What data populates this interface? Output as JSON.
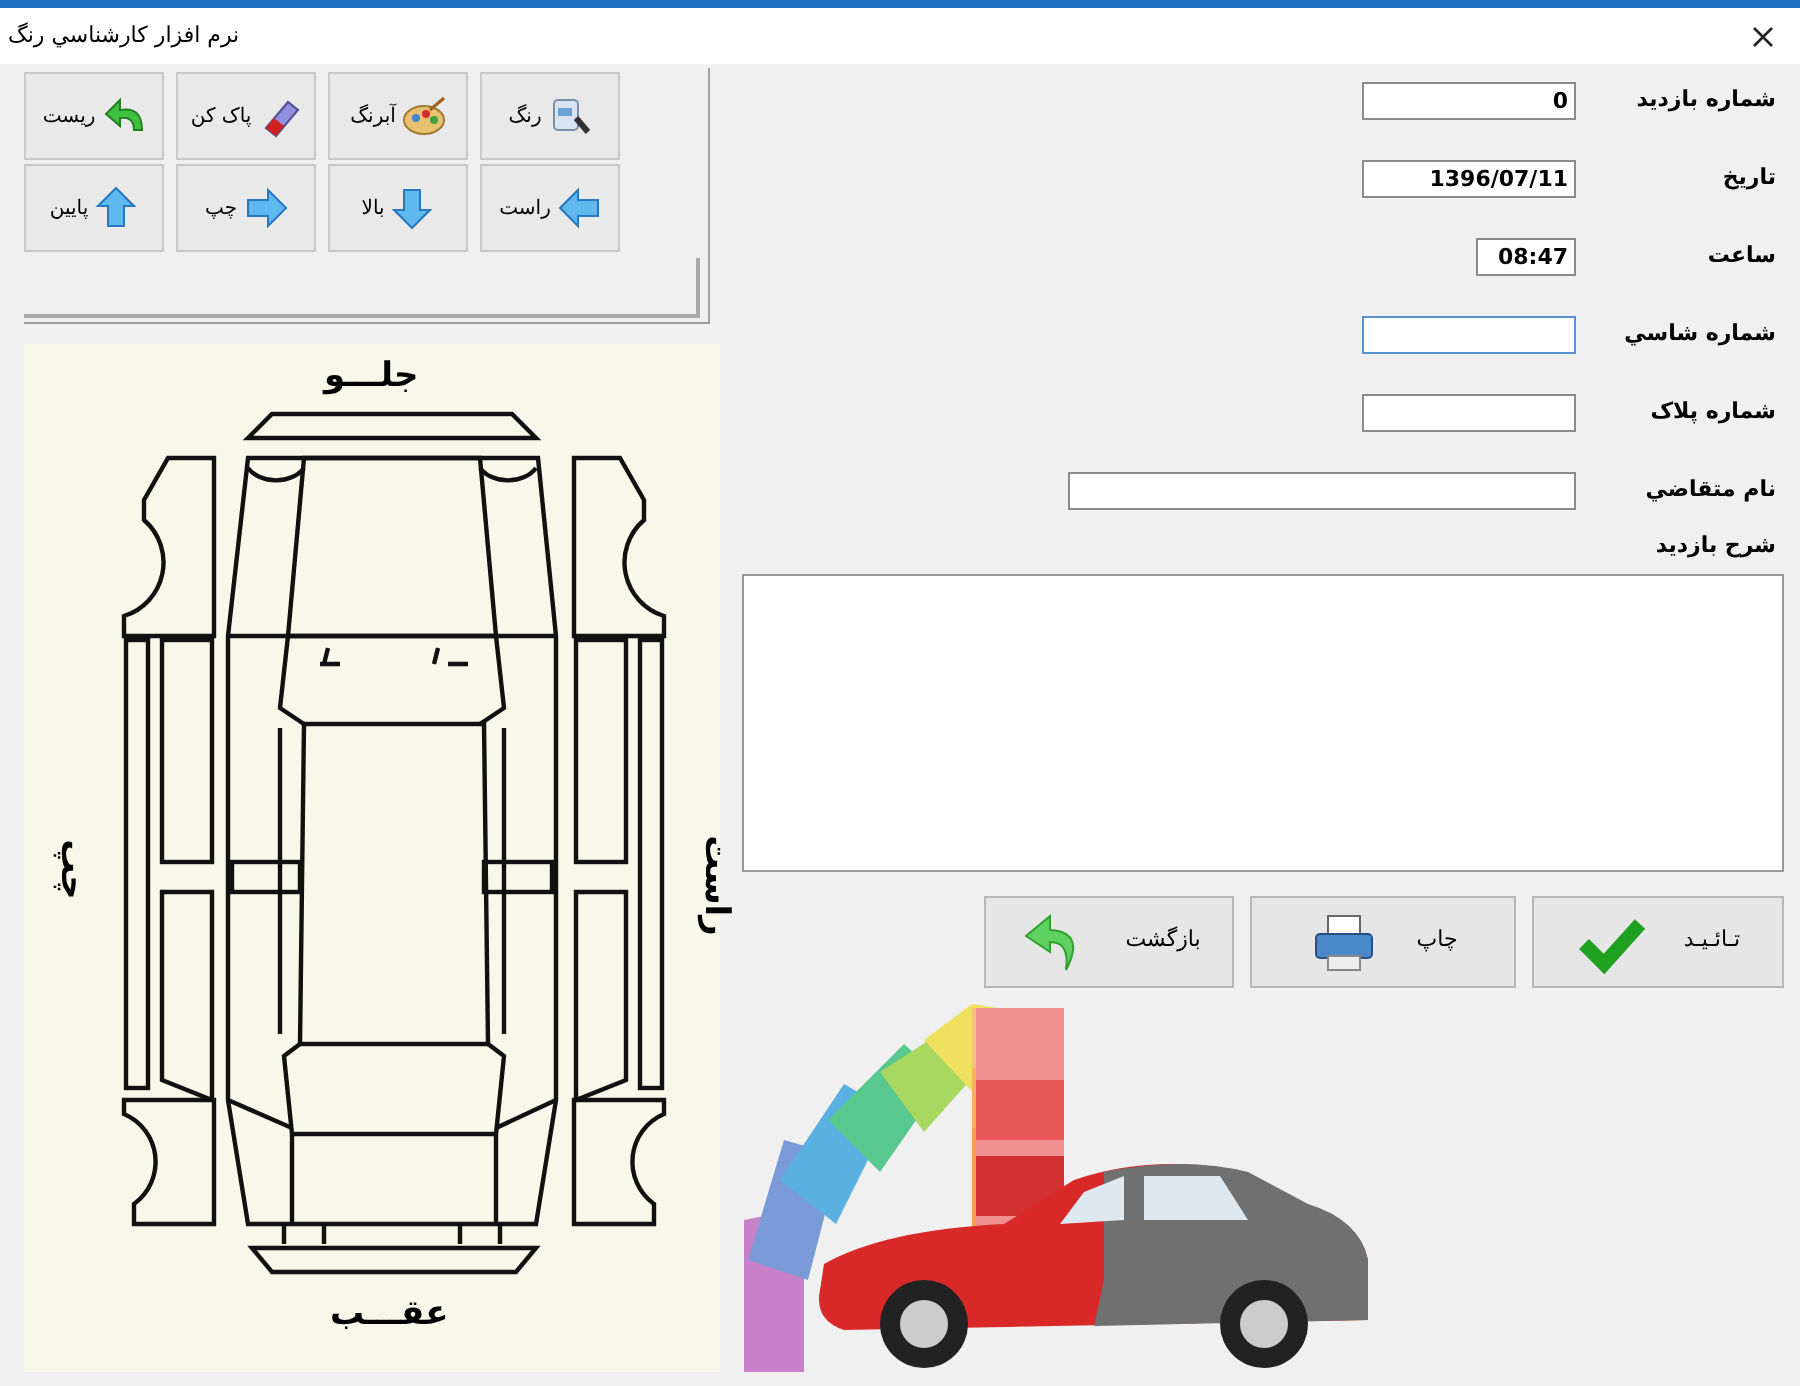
{
  "window": {
    "title": "نرم افزار کارشناسي رنگ"
  },
  "toolbar": {
    "buttons": [
      {
        "label": "رنگ",
        "kind": "paint"
      },
      {
        "label": "آبرنگ",
        "kind": "palette"
      },
      {
        "label": "پاک کن",
        "kind": "eraser"
      },
      {
        "label": "ریست",
        "kind": "reset"
      },
      {
        "label": "راست",
        "kind": "arrow-left"
      },
      {
        "label": "بالا",
        "kind": "arrow-down"
      },
      {
        "label": "چپ",
        "kind": "arrow-right"
      },
      {
        "label": "پایین",
        "kind": "arrow-up"
      }
    ]
  },
  "diagram": {
    "front": "جلـــو",
    "rear": "عقـــب",
    "left": "چپ",
    "right": "راست"
  },
  "form": {
    "fields": [
      {
        "label": "شماره بازدید",
        "value": "0",
        "focused": false
      },
      {
        "label": "تاریخ",
        "value": "1396/07/11",
        "focused": false
      },
      {
        "label": "ساعت",
        "value": "08:47",
        "focused": false
      },
      {
        "label": "شماره شاسي",
        "focused": true
      },
      {
        "label": "شماره پلاک",
        "focused": false
      },
      {
        "label": "نام متقاضي",
        "focused": false
      }
    ],
    "notes": {
      "label": "شرح بازدید"
    }
  },
  "actions": [
    {
      "label": "تـائـیـد",
      "kind": "confirm"
    },
    {
      "label": "چاپ",
      "kind": "print"
    },
    {
      "label": "بازگشت",
      "kind": "back"
    }
  ]
}
